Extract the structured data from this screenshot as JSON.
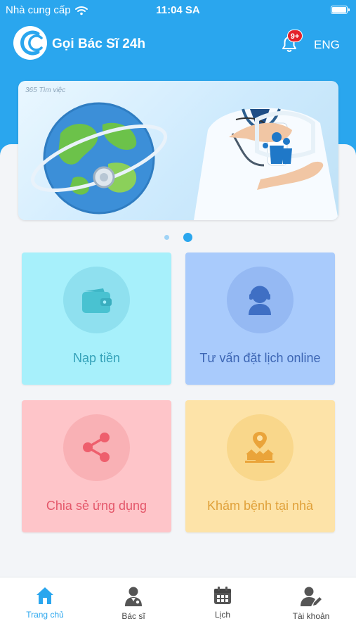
{
  "status_bar": {
    "carrier": "Nhà cung cấp",
    "time": "11:04 SA"
  },
  "app_bar": {
    "title": "Gọi Bác Sĩ 24h",
    "notification_badge": "9+",
    "language": "ENG"
  },
  "banner": {
    "tag": "365 Tìm việc",
    "page_indicator": {
      "count": 2,
      "active_index": 1
    }
  },
  "features": [
    {
      "label": "Nạp tiền",
      "icon": "wallet-icon"
    },
    {
      "label": "Tư vấn đặt lịch online",
      "icon": "support-agent-icon"
    },
    {
      "label": "Chia sẻ ứng dụng",
      "icon": "share-icon"
    },
    {
      "label": "Khám bệnh tại nhà",
      "icon": "home-location-icon"
    }
  ],
  "tabbar": [
    {
      "label": "Trang chủ",
      "icon": "home-icon",
      "active": true
    },
    {
      "label": "Bác sĩ",
      "icon": "doctor-icon",
      "active": false
    },
    {
      "label": "Lịch",
      "icon": "calendar-icon",
      "active": false
    },
    {
      "label": "Tài khoản",
      "icon": "account-edit-icon",
      "active": false
    }
  ],
  "colors": {
    "primary": "#2aa6ee",
    "topup_card": "#a7f0fb",
    "consult_card": "#a9cbfc",
    "share_card": "#fec5c9",
    "home_card": "#fde3a8",
    "badge": "#e3222b"
  }
}
